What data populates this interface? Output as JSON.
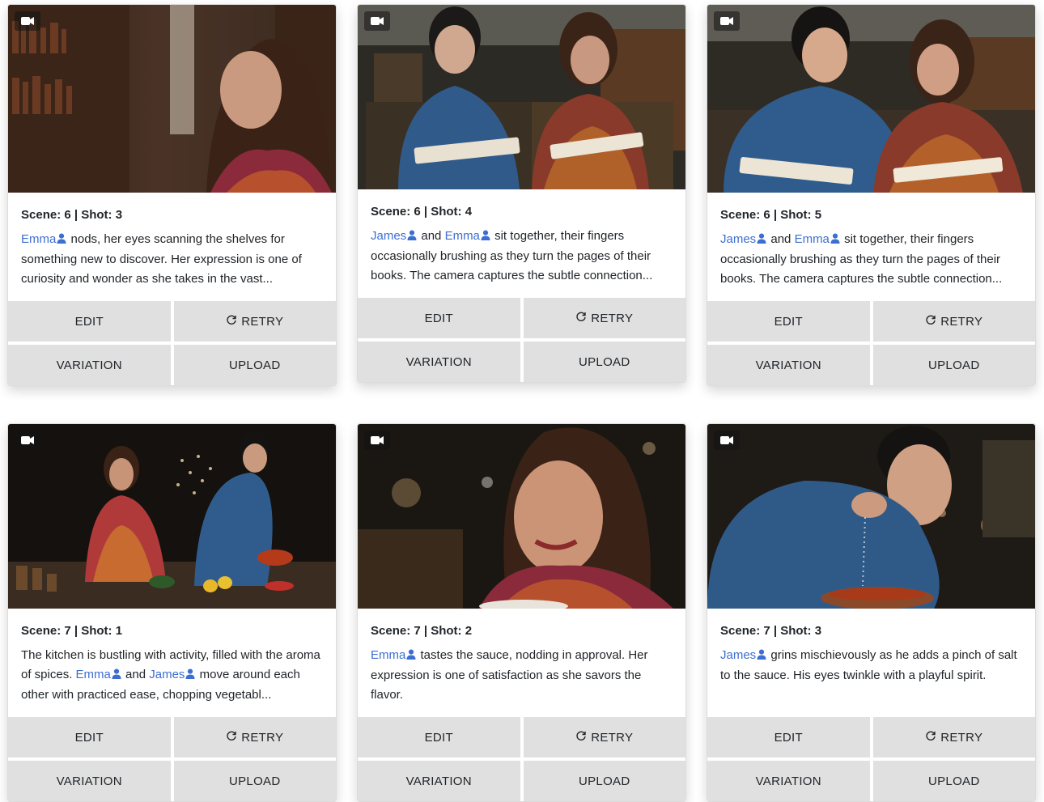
{
  "cards": [
    {
      "heading": "Scene: 6 | Shot: 3",
      "segments": [
        {
          "char": "Emma"
        },
        {
          "text": " nods, her eyes scanning the shelves for something new to discover. Her expression is one of curiosity and wonder as she takes in the vast..."
        }
      ],
      "buttons": {
        "edit": "EDIT",
        "retry": "RETRY",
        "variation": "VARIATION",
        "upload": "UPLOAD"
      }
    },
    {
      "heading": "Scene: 6 | Shot: 4",
      "segments": [
        {
          "char": "James"
        },
        {
          "text": " and "
        },
        {
          "char": "Emma"
        },
        {
          "text": " sit together, their fingers occasionally brushing as they turn the pages of their books. The camera captures the subtle connection..."
        }
      ],
      "buttons": {
        "edit": "EDIT",
        "retry": "RETRY",
        "variation": "VARIATION",
        "upload": "UPLOAD"
      }
    },
    {
      "heading": "Scene: 6 | Shot: 5",
      "segments": [
        {
          "char": "James"
        },
        {
          "text": " and "
        },
        {
          "char": "Emma"
        },
        {
          "text": " sit together, their fingers occasionally brushing as they turn the pages of their books. The camera captures the subtle connection..."
        }
      ],
      "buttons": {
        "edit": "EDIT",
        "retry": "RETRY",
        "variation": "VARIATION",
        "upload": "UPLOAD"
      }
    },
    {
      "heading": "Scene: 7 | Shot: 1",
      "segments": [
        {
          "text": "The kitchen is bustling with activity, filled with the aroma of spices. "
        },
        {
          "char": "Emma"
        },
        {
          "text": " and "
        },
        {
          "char": "James"
        },
        {
          "text": " move around each other with practiced ease, chopping vegetabl..."
        }
      ],
      "buttons": {
        "edit": "EDIT",
        "retry": "RETRY",
        "variation": "VARIATION",
        "upload": "UPLOAD"
      }
    },
    {
      "heading": "Scene: 7 | Shot: 2",
      "segments": [
        {
          "char": "Emma"
        },
        {
          "text": " tastes the sauce, nodding in approval. Her expression is one of satisfaction as she savors the flavor."
        }
      ],
      "buttons": {
        "edit": "EDIT",
        "retry": "RETRY",
        "variation": "VARIATION",
        "upload": "UPLOAD"
      }
    },
    {
      "heading": "Scene: 7 | Shot: 3",
      "segments": [
        {
          "char": "James"
        },
        {
          "text": " grins mischievously as he adds a pinch of salt to the sauce. His eyes twinkle with a playful spirit."
        }
      ],
      "buttons": {
        "edit": "EDIT",
        "retry": "RETRY",
        "variation": "VARIATION",
        "upload": "UPLOAD"
      }
    }
  ],
  "colors": {
    "character_link": "#3d6fd1",
    "button_bg": "#e0e0e0"
  },
  "icons": {
    "thumbnail_badge": "video-camera-icon",
    "character": "person-icon",
    "retry": "refresh-icon"
  }
}
